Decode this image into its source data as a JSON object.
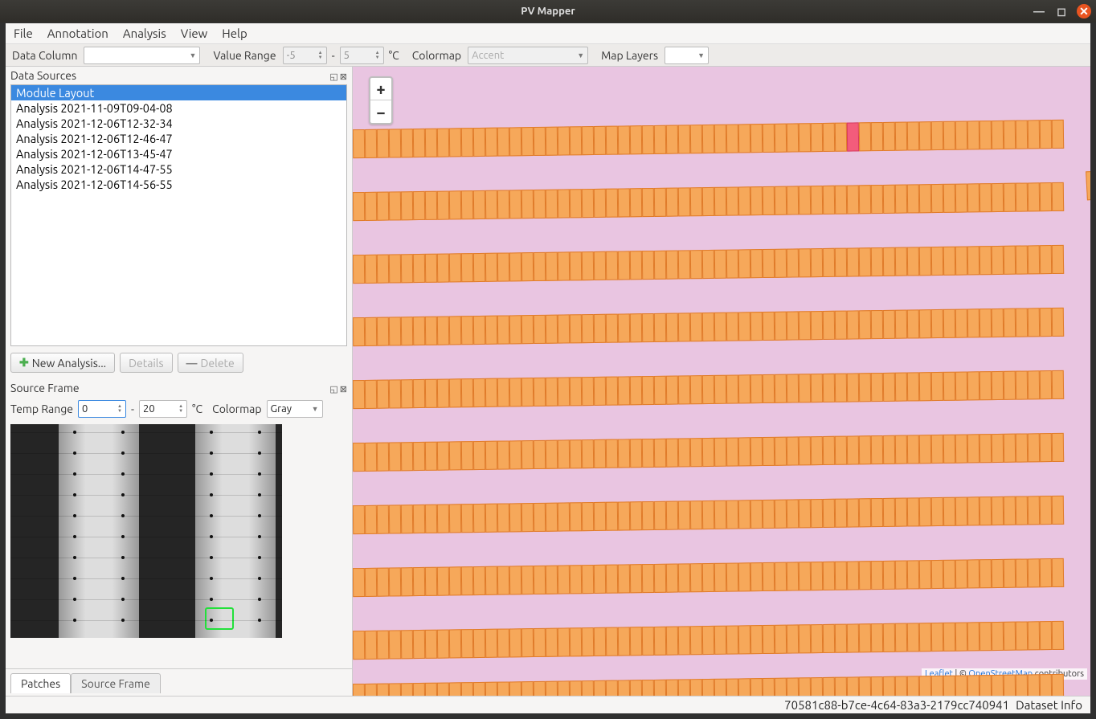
{
  "title": "PV Mapper",
  "menu": {
    "file": "File",
    "annotation": "Annotation",
    "analysis": "Analysis",
    "view": "View",
    "help": "Help"
  },
  "toolbar": {
    "data_column_label": "Data Column",
    "data_column_value": "",
    "value_range_label": "Value Range",
    "value_range_min": "-5",
    "value_range_max": "5",
    "dash": "-",
    "unit": "°C",
    "colormap_label": "Colormap",
    "colormap_value": "Accent",
    "map_layers_label": "Map Layers",
    "map_layers_value": ""
  },
  "data_sources": {
    "title": "Data Sources",
    "items": [
      "Module Layout",
      "Analysis 2021-11-09T09-04-08",
      "Analysis 2021-12-06T12-32-34",
      "Analysis 2021-12-06T12-46-47",
      "Analysis 2021-12-06T13-45-47",
      "Analysis 2021-12-06T14-47-55",
      "Analysis 2021-12-06T14-56-55"
    ],
    "selected_index": 0,
    "new_analysis": "New Analysis...",
    "details": "Details",
    "delete": "Delete"
  },
  "source_frame": {
    "title": "Source Frame",
    "temp_range_label": "Temp Range",
    "temp_min": "0",
    "temp_max": "20",
    "unit": "°C",
    "dash": "-",
    "colormap_label": "Colormap",
    "colormap_value": "Gray"
  },
  "tabs": {
    "patches": "Patches",
    "source_frame": "Source Frame"
  },
  "map": {
    "zoom_in": "+",
    "zoom_out": "−",
    "attribution_leaflet": "Leaflet",
    "attribution_sep": " | © ",
    "attribution_osm": "OpenStreetMap",
    "attribution_tail": " contributors"
  },
  "status": {
    "uuid": "70581c88-b7ce-4c64-83a3-2179cc740941",
    "label": "Dataset Info"
  }
}
